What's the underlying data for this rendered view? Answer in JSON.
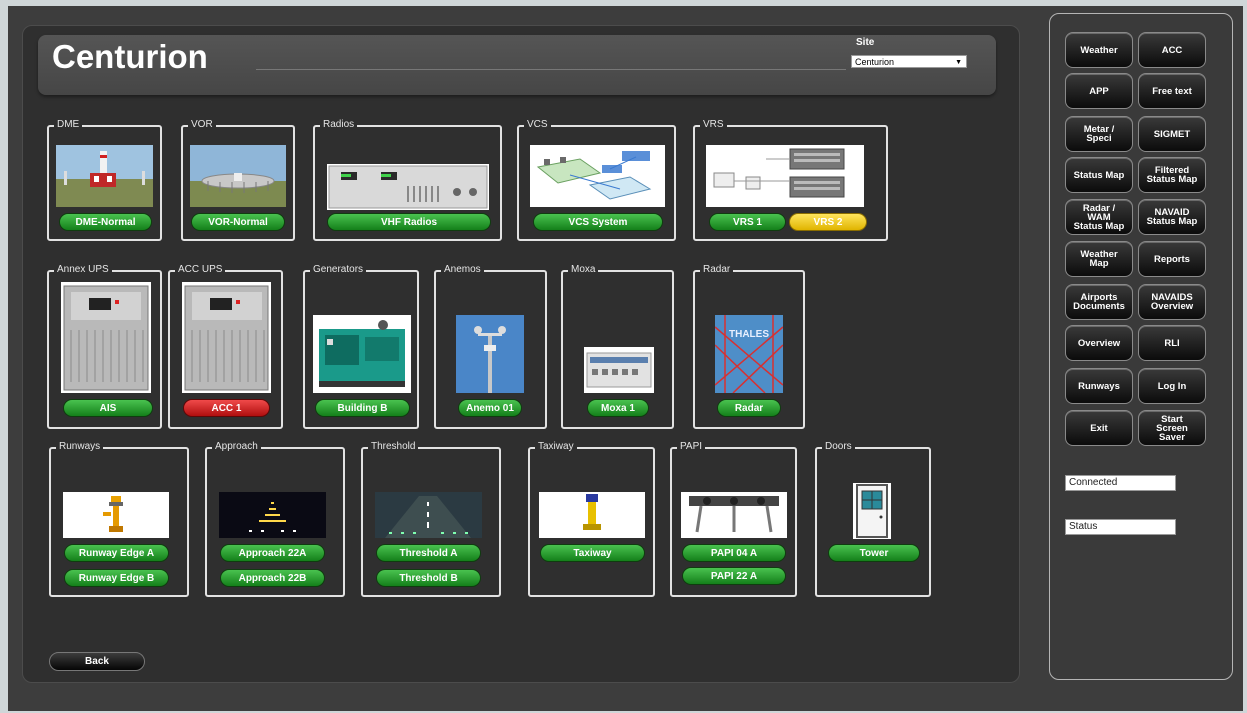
{
  "app": {
    "title": "Centurion"
  },
  "site": {
    "label": "Site",
    "value": "Centurion"
  },
  "groups": {
    "dme": {
      "label": "DME",
      "buttons": [
        "DME-Normal"
      ]
    },
    "vor": {
      "label": "VOR",
      "buttons": [
        "VOR-Normal"
      ]
    },
    "radios": {
      "label": "Radios",
      "buttons": [
        "VHF Radios"
      ]
    },
    "vcs": {
      "label": "VCS",
      "buttons": [
        "VCS System"
      ]
    },
    "vrs": {
      "label": "VRS",
      "buttons": [
        "VRS 1",
        "VRS 2"
      ]
    },
    "annex_ups": {
      "label": "Annex UPS",
      "buttons": [
        "AIS"
      ]
    },
    "acc_ups": {
      "label": "ACC UPS",
      "buttons": [
        "ACC 1"
      ]
    },
    "generators": {
      "label": "Generators",
      "buttons": [
        "Building B"
      ]
    },
    "anemos": {
      "label": "Anemos",
      "buttons": [
        "Anemo 01"
      ]
    },
    "moxa": {
      "label": "Moxa",
      "buttons": [
        "Moxa 1"
      ]
    },
    "radar": {
      "label": "Radar",
      "buttons": [
        "Radar"
      ],
      "image_text": "THALES"
    },
    "runways": {
      "label": "Runways",
      "buttons": [
        "Runway Edge A",
        "Runway Edge B"
      ]
    },
    "approach": {
      "label": "Approach",
      "buttons": [
        "Approach 22A",
        "Approach 22B"
      ]
    },
    "threshold": {
      "label": "Threshold",
      "buttons": [
        "Threshold A",
        "Threshold B"
      ]
    },
    "taxiway": {
      "label": "Taxiway",
      "buttons": [
        "Taxiway"
      ]
    },
    "papi": {
      "label": "PAPI",
      "buttons": [
        "PAPI 04 A",
        "PAPI 22 A"
      ]
    },
    "doors": {
      "label": "Doors",
      "buttons": [
        "Tower"
      ]
    }
  },
  "status_colors": {
    "normal": "#1f9a26",
    "alarm": "#d11a1a",
    "warning": "#f2cc1e"
  },
  "back_label": "Back",
  "sidebar": {
    "buttons": [
      [
        "Weather"
      ],
      [
        "ACC"
      ],
      [
        "APP"
      ],
      [
        "Free text"
      ],
      [
        "Metar /",
        "Speci"
      ],
      [
        "SIGMET"
      ],
      [
        "Status Map"
      ],
      [
        "Filtered",
        "Status Map"
      ],
      [
        "Radar /",
        "WAM",
        "Status Map"
      ],
      [
        "NAVAID",
        "Status Map"
      ],
      [
        "Weather",
        "Map"
      ],
      [
        "Reports"
      ],
      [
        "Airports",
        "Documents"
      ],
      [
        "NAVAIDS",
        "Overview"
      ],
      [
        "Overview"
      ],
      [
        "RLI"
      ],
      [
        "Runways"
      ],
      [
        "Log In"
      ],
      [
        "Exit"
      ],
      [
        "Start",
        "Screen",
        "Saver"
      ]
    ],
    "connection": "Connected",
    "status": "Status"
  }
}
